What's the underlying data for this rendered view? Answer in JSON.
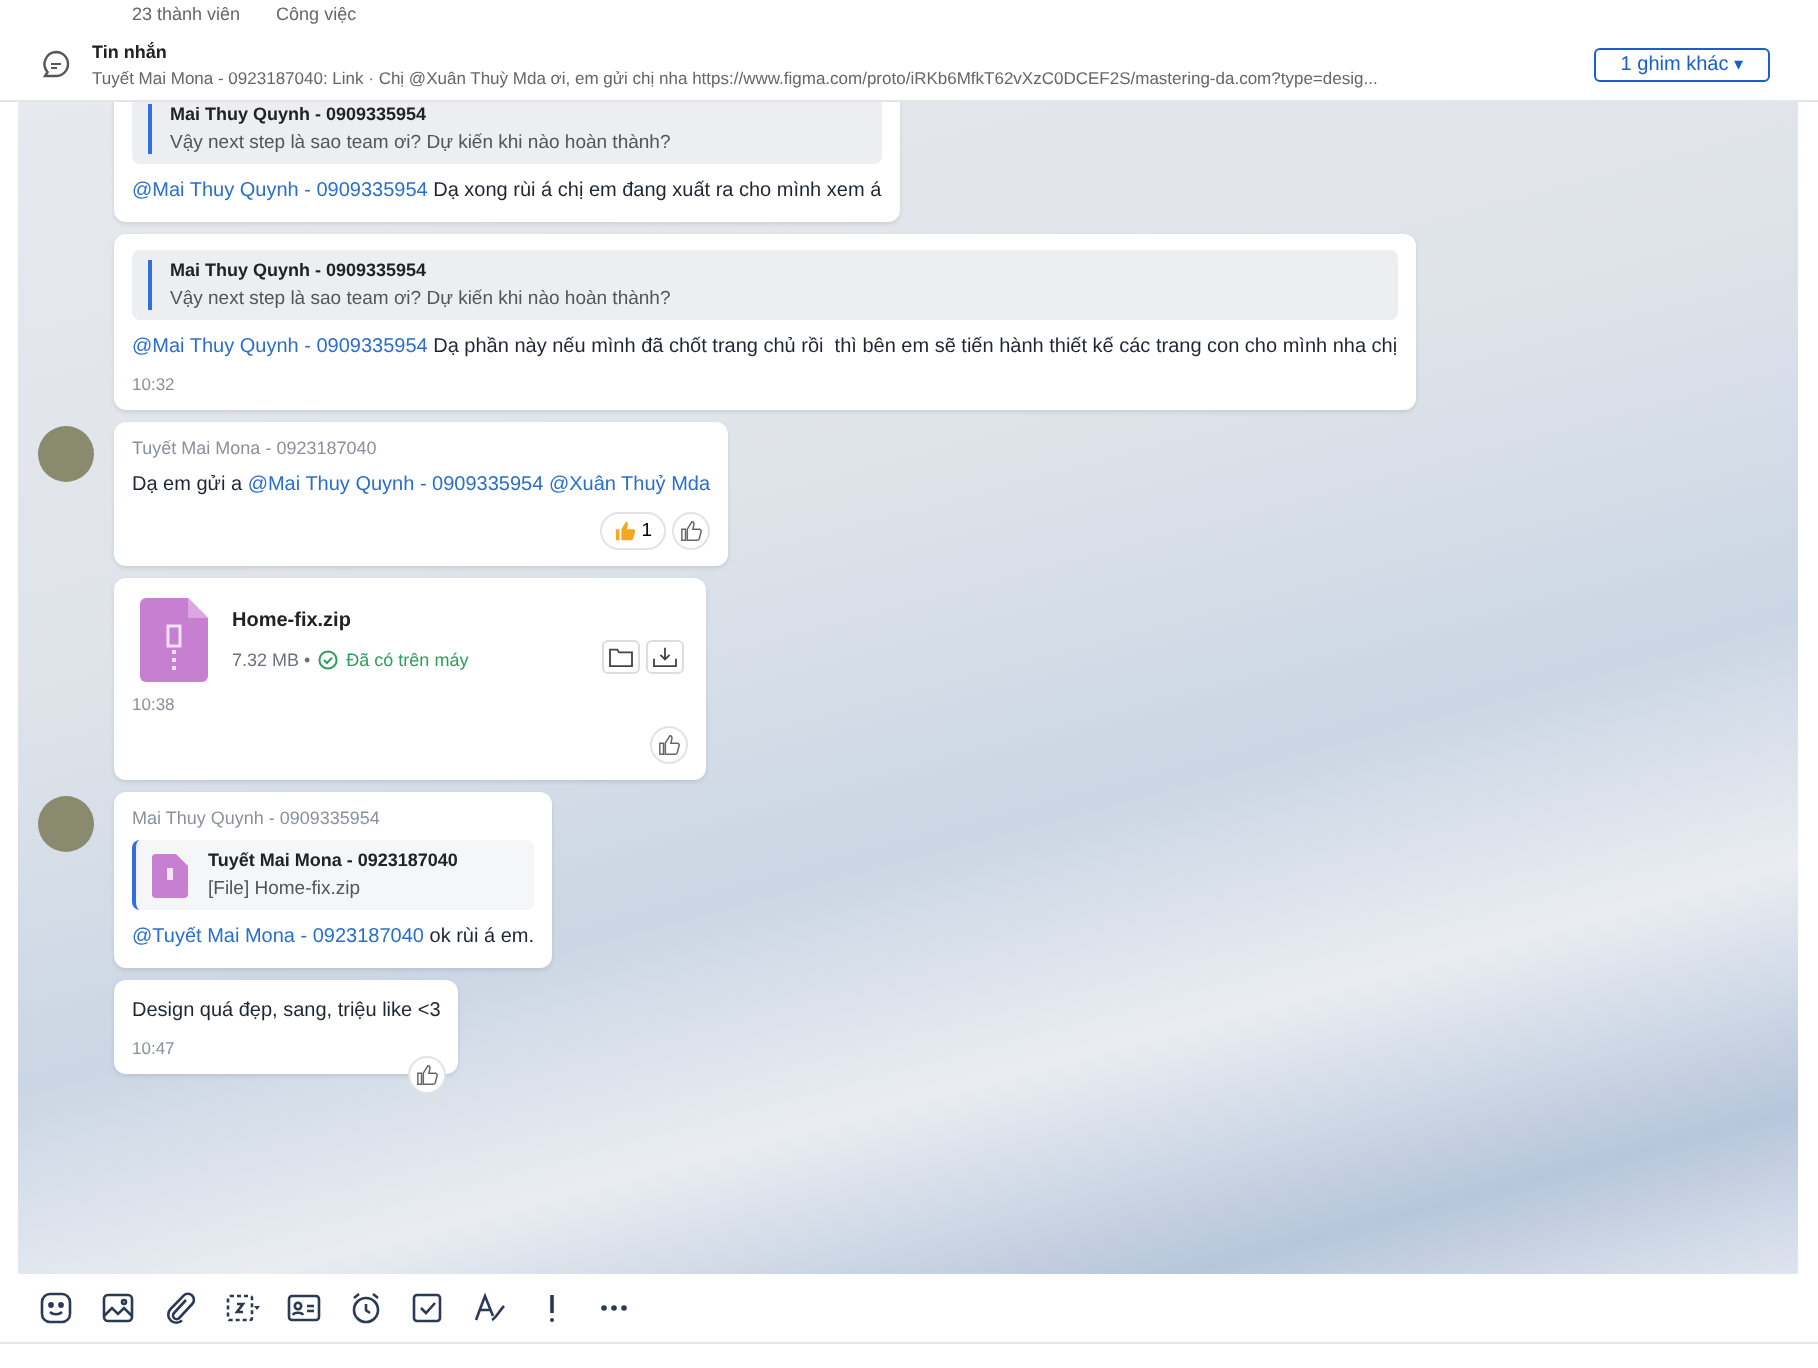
{
  "header": {
    "members": "23 thành viên",
    "tasks": "Công việc"
  },
  "pinned": {
    "label": "Tin nhắn",
    "preview": "Tuyết Mai Mona - 0923187040:  Link · Chị @Xuân Thuỳ Mda ơi, em gửi chị nha https://www.figma.com/proto/iRKb6MfkT62vXzC0DCEF2S/mastering-da.com?type=desig...",
    "more_button": "1 ghim khác",
    "more_caret": "▾"
  },
  "messages": [
    {
      "kind": "text",
      "quote": {
        "name": "Mai Thuy Quynh - 0909335954",
        "text": "Vậy next step là sao team ơi? Dự kiến khi nào hoàn thành?",
        "file": false
      },
      "parts": [
        {
          "kind": "mention",
          "text": "@Mai Thuy Quynh - 0909335954"
        },
        {
          "kind": "plain",
          "text": " Dạ xong rùi á chị em đang xuất ra cho mình xem á"
        }
      ]
    },
    {
      "kind": "text",
      "quote": {
        "name": "Mai Thuy Quynh - 0909335954",
        "text": "Vậy next step là sao team ơi? Dự kiến khi nào hoàn thành?",
        "file": false
      },
      "parts": [
        {
          "kind": "mention",
          "text": "@Mai Thuy Quynh - 0909335954"
        },
        {
          "kind": "plain",
          "text": " Dạ phần này nếu mình đã chốt trang chủ rồi  thì bên em sẽ tiến hành thiết kế các trang con cho mình nha chị"
        }
      ],
      "time": "10:32"
    },
    {
      "kind": "text",
      "avatar": true,
      "sender": "Tuyết Mai Mona - 0923187040",
      "parts": [
        {
          "kind": "plain",
          "text": "Dạ em gửi a "
        },
        {
          "kind": "mention",
          "text": "@Mai Thuy Quynh - 0909335954"
        },
        {
          "kind": "mention",
          "text": "@Xuân Thuỷ Mda"
        }
      ],
      "reaction_count": "1",
      "like_button": true
    },
    {
      "kind": "file",
      "file_name": "Home-fix.zip",
      "file_size": "7.32 MB",
      "separator": "•",
      "file_status": "Đã có trên máy",
      "time": "10:38",
      "like_button": true
    },
    {
      "kind": "text",
      "avatar": true,
      "sender": "Mai Thuy Quynh - 0909335954",
      "quote": {
        "name": "Tuyết Mai Mona - 0923187040",
        "text": "[File] Home-fix.zip",
        "file": true
      },
      "parts": [
        {
          "kind": "mention",
          "text": "@Tuyết Mai Mona - 0923187040"
        },
        {
          "kind": "plain",
          "text": " ok rùi á em."
        }
      ]
    },
    {
      "kind": "text",
      "parts": [
        {
          "kind": "plain",
          "text": "Design quá đẹp, sang, triệu like <3"
        }
      ],
      "time": "10:47",
      "like_button": true
    }
  ]
}
